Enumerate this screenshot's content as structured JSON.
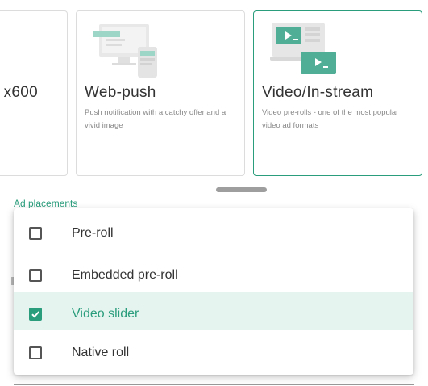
{
  "cards": [
    {
      "title": "x600",
      "description": ""
    },
    {
      "title": "Web-push",
      "description": "Push notification with a catchy offer and a vivid image"
    },
    {
      "title": "Video/In-stream",
      "description": "Video pre-rolls - one of the most popular video ad formats"
    }
  ],
  "field": {
    "label": "Ad placements"
  },
  "dropdown": {
    "options": [
      {
        "label": "Pre-roll",
        "checked": false
      },
      {
        "label": "Embedded pre-roll",
        "checked": false
      },
      {
        "label": "Video slider",
        "checked": true
      },
      {
        "label": "Native roll",
        "checked": false
      }
    ]
  },
  "colors": {
    "accent": "#2a9d7c",
    "selected_bg": "#e5f4ef"
  },
  "icons": [
    "webpush-illustration-icon",
    "video-illustration-icon",
    "checkbox-check-icon"
  ]
}
